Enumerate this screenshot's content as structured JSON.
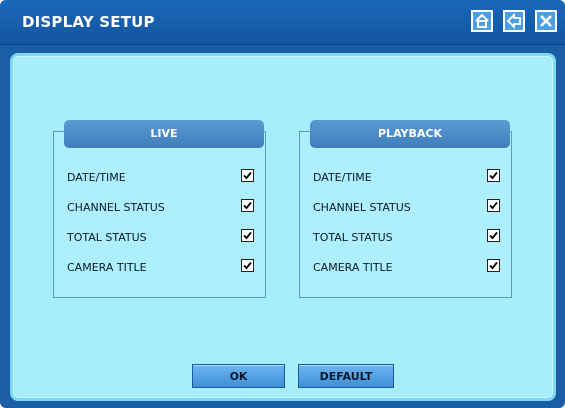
{
  "window": {
    "title": "DISPLAY SETUP",
    "controls": [
      "home-icon",
      "back-arrow-icon",
      "close-icon"
    ]
  },
  "groups": {
    "live": {
      "label": "LIVE",
      "items": [
        {
          "label": "DATE/TIME",
          "checked": true
        },
        {
          "label": "CHANNEL STATUS",
          "checked": true
        },
        {
          "label": "TOTAL STATUS",
          "checked": true
        },
        {
          "label": "CAMERA TITLE",
          "checked": true
        }
      ]
    },
    "playback": {
      "label": "PLAYBACK",
      "items": [
        {
          "label": "DATE/TIME",
          "checked": true
        },
        {
          "label": "CHANNEL STATUS",
          "checked": true
        },
        {
          "label": "TOTAL STATUS",
          "checked": true
        },
        {
          "label": "CAMERA TITLE",
          "checked": true
        }
      ]
    }
  },
  "buttons": {
    "ok": "OK",
    "default": "DEFAULT"
  },
  "colors": {
    "title_bar": "#1a5ea8",
    "panel_bg": "#a8edfb",
    "group_header": "#4a8bc8",
    "button": "#55a2e4"
  }
}
